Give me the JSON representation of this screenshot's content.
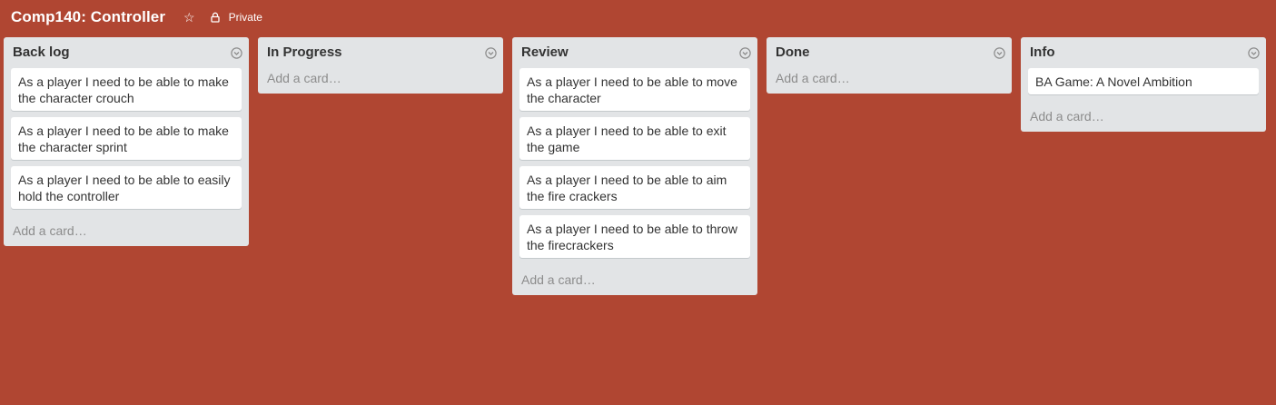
{
  "board": {
    "title": "Comp140: Controller",
    "privacy": "Private",
    "icons": {
      "star": "star-icon",
      "lock": "lock-icon",
      "list_menu": "chevron-down-circle-icon"
    },
    "background_color": "#b04632"
  },
  "lists": [
    {
      "title": "Back log",
      "cards": [
        "As a player I need to be able to make the character crouch",
        "As a player I need to be able to make the character sprint",
        "As a player I need to be able to easily hold the controller"
      ],
      "add_card": "Add a card…"
    },
    {
      "title": "In Progress",
      "cards": [],
      "add_card": "Add a card…"
    },
    {
      "title": "Review",
      "cards": [
        "As a player I need to be able to move the character",
        "As a player I need to be able to exit the game",
        "As a player I need to be able to aim the fire crackers",
        "As a player I need to be able to throw the firecrackers"
      ],
      "add_card": "Add a card…"
    },
    {
      "title": "Done",
      "cards": [],
      "add_card": "Add a card…"
    },
    {
      "title": "Info",
      "cards": [
        "BA Game: A Novel Ambition"
      ],
      "add_card": "Add a card…"
    }
  ]
}
